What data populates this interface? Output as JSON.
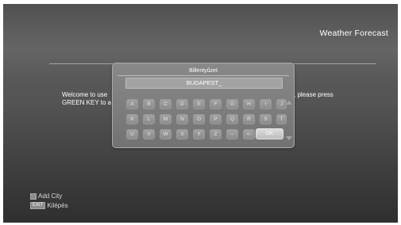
{
  "header": {
    "title": "Weather Forecast"
  },
  "welcome": {
    "part1": "Welcome to use",
    "part2": "GREEN KEY to a",
    "part3": ", please press"
  },
  "keyboard": {
    "title": "Billentyűzet",
    "input_value": "BUDAPEST_",
    "rows": [
      [
        "A",
        "B",
        "C",
        "D",
        "E",
        "F",
        "G",
        "H",
        "I",
        "J"
      ],
      [
        "K",
        "L",
        "M",
        "N",
        "O",
        "P",
        "Q",
        "R",
        "S",
        "T"
      ],
      [
        "U",
        "V",
        "W",
        "X",
        "Y",
        "Z",
        "–",
        "<-"
      ]
    ],
    "ok_label": "OK"
  },
  "legend": {
    "add_city_label": "Add City",
    "exit_key_label": "EXIT",
    "exit_label": "Kilépés"
  }
}
